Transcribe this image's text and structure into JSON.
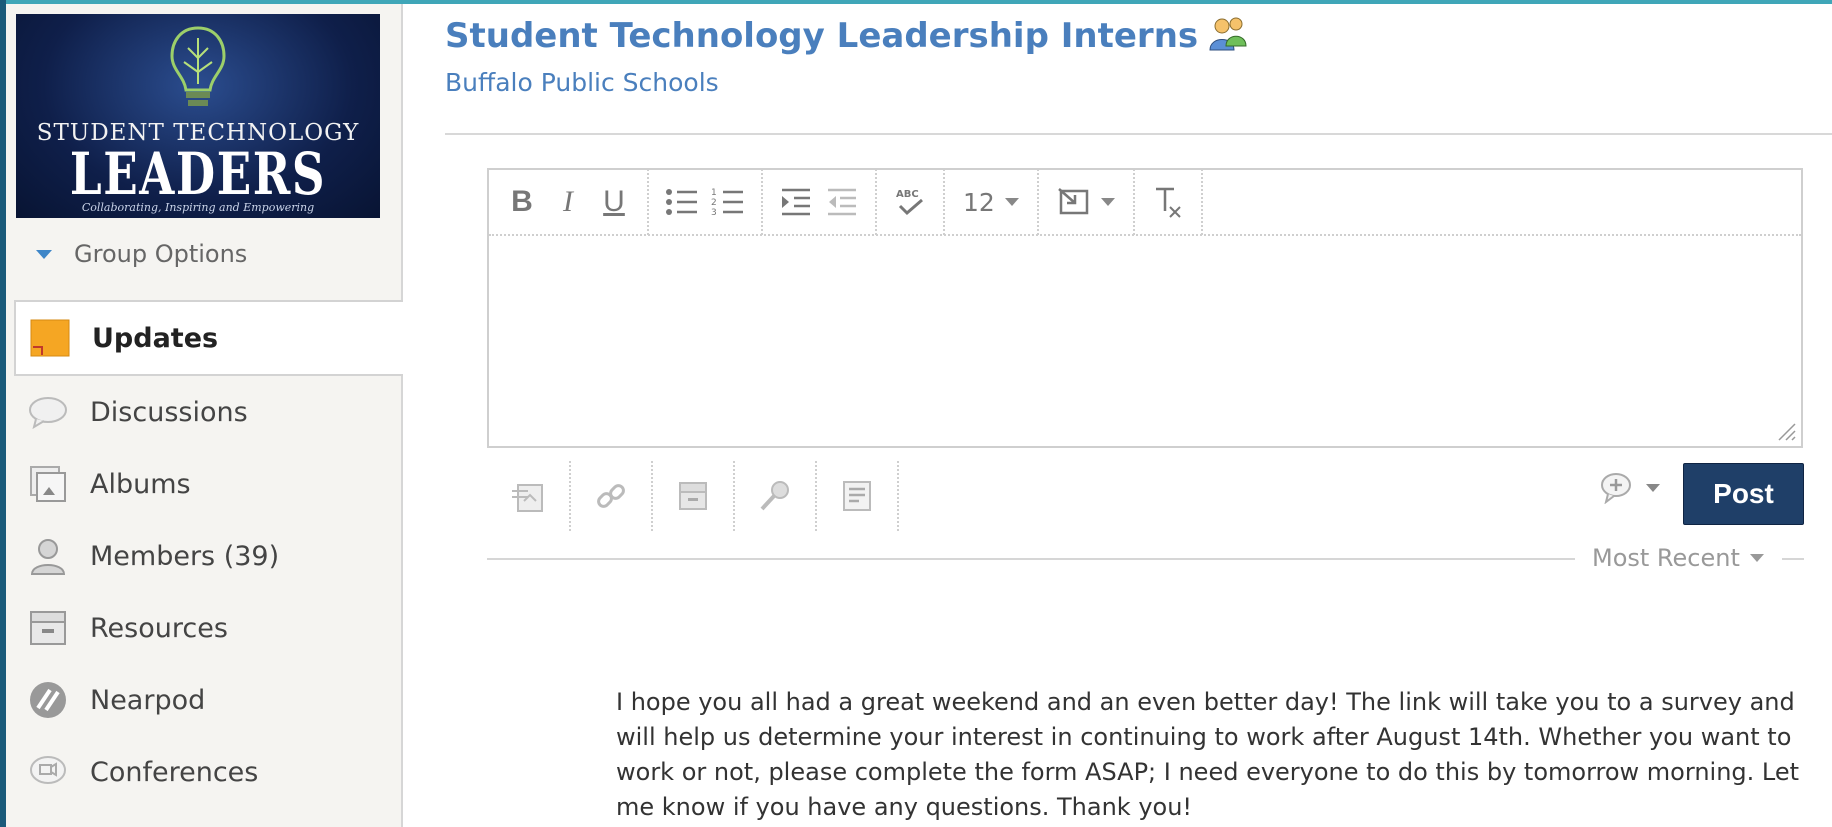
{
  "logo": {
    "line1": "STUDENT TECHNOLOGY",
    "line2": "LEADERS",
    "tagline": "Collaborating, Inspiring and Empowering"
  },
  "group_options": "Group Options",
  "nav": [
    {
      "label": "Updates",
      "icon": "sticky-note-icon",
      "active": true
    },
    {
      "label": "Discussions",
      "icon": "chat-bubble-icon"
    },
    {
      "label": "Albums",
      "icon": "album-icon"
    },
    {
      "label": "Members (39)",
      "icon": "member-icon"
    },
    {
      "label": "Resources",
      "icon": "drawer-icon"
    },
    {
      "label": "Nearpod",
      "icon": "nearpod-icon"
    },
    {
      "label": "Conferences",
      "icon": "video-chat-icon"
    }
  ],
  "header": {
    "title": "Student Technology Leadership Interns",
    "subtitle": "Buffalo Public Schools"
  },
  "editor": {
    "font_size": "12",
    "body": ""
  },
  "post_button": "Post",
  "sort": "Most Recent",
  "post": {
    "text": "I hope you all had a great weekend and an even better day!  The link will take you to a survey and will help us determine your interest in continuing to work after August 14th.  Whether you want to work or not, please complete the form ASAP; I need everyone to do this by tomorrow morning.  Let me know if you have any questions. Thank you!"
  },
  "colors": {
    "accent": "#4a7fbd",
    "post_button": "#1f3f68",
    "frame": "#3fa6b8"
  }
}
